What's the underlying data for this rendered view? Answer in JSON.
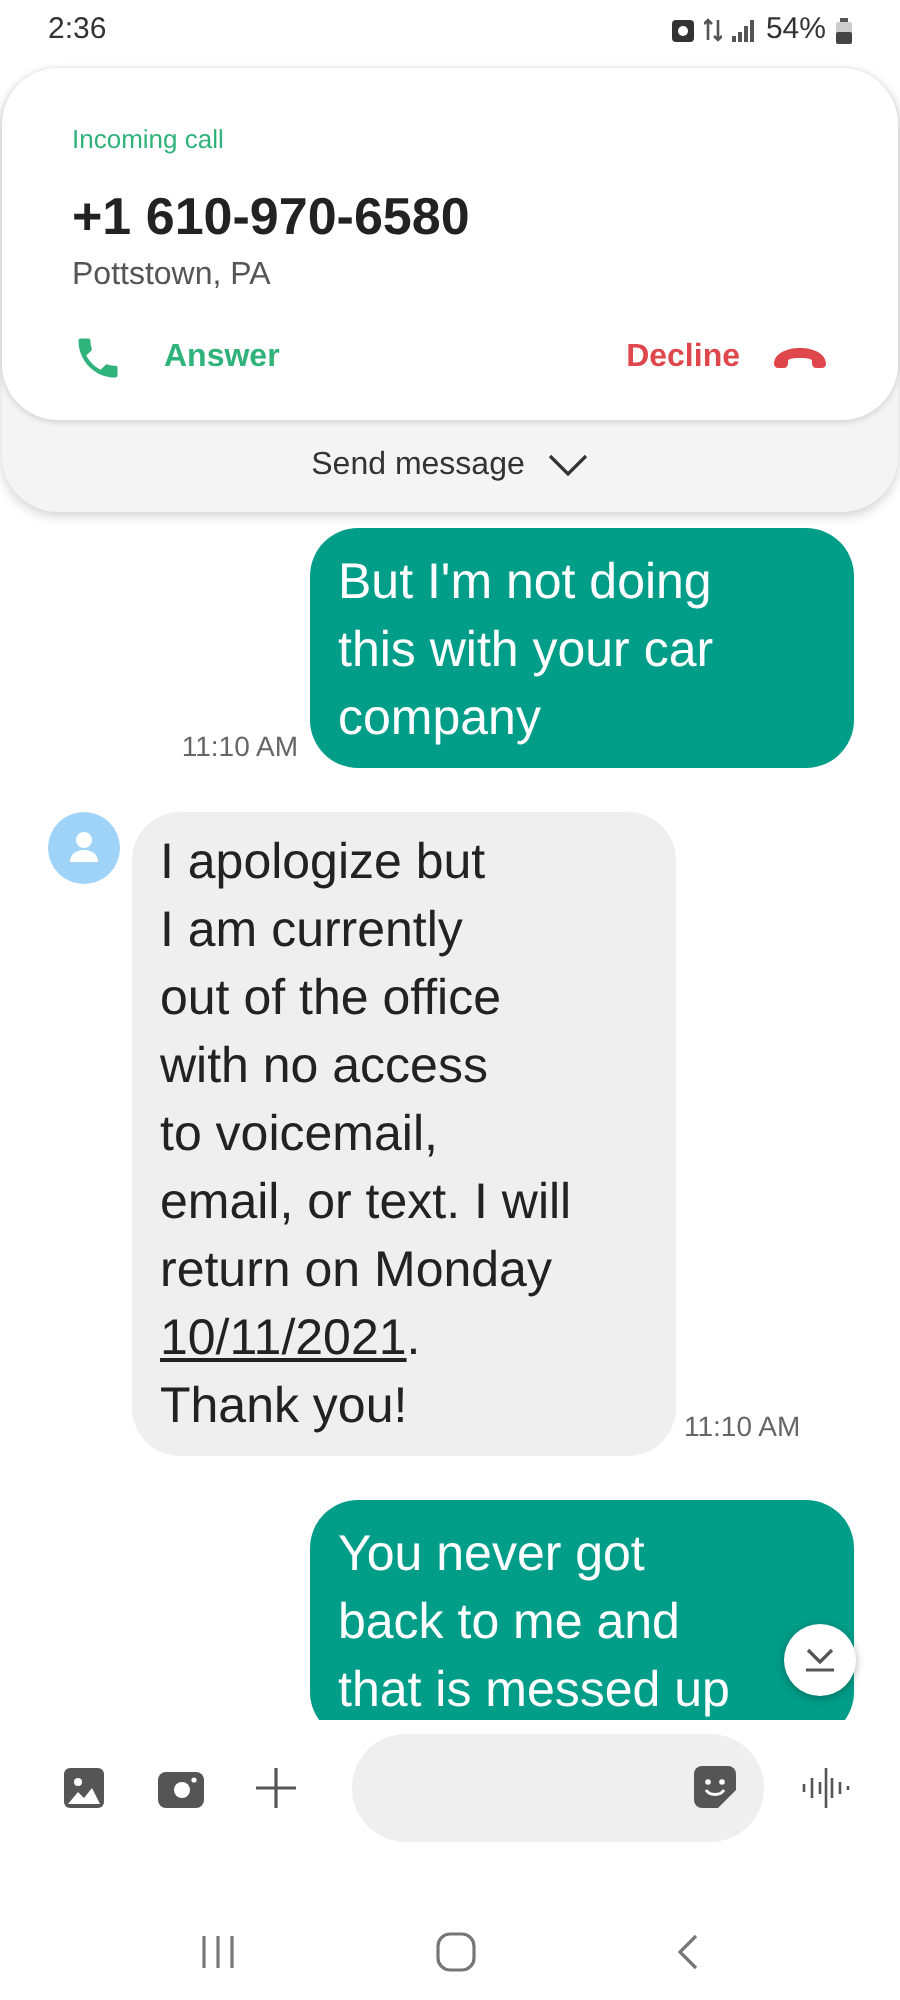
{
  "status_bar": {
    "time": "2:36",
    "battery": "54%"
  },
  "incoming_call": {
    "label": "Incoming call",
    "number": "+1 610-970-6580",
    "location": "Pottstown, PA",
    "answer": "Answer",
    "decline": "Decline",
    "send_message": "Send message"
  },
  "messages": [
    {
      "kind": "outgoing",
      "lines": [
        [
          {
            "kind": "text",
            "text": "But I'm not doing"
          }
        ],
        [
          {
            "kind": "text",
            "text": "this with your car"
          }
        ],
        [
          {
            "kind": "text",
            "text": "company"
          }
        ]
      ],
      "time": "11:10 AM"
    },
    {
      "kind": "incoming",
      "lines": [
        [
          {
            "kind": "text",
            "text": "I apologize but"
          }
        ],
        [
          {
            "kind": "text",
            "text": "I am currently"
          }
        ],
        [
          {
            "kind": "text",
            "text": "out of the office"
          }
        ],
        [
          {
            "kind": "text",
            "text": "with no access"
          }
        ],
        [
          {
            "kind": "text",
            "text": "to voicemail,"
          }
        ],
        [
          {
            "kind": "text",
            "text": "email, or text. I will"
          }
        ],
        [
          {
            "kind": "text",
            "text": "return on Monday"
          }
        ],
        [
          {
            "kind": "link",
            "text": "10/11/2021"
          },
          {
            "kind": "text",
            "text": "."
          }
        ],
        [
          {
            "kind": "text",
            "text": "Thank you!"
          }
        ]
      ],
      "time": "11:10 AM"
    },
    {
      "kind": "outgoing",
      "lines": [
        [
          {
            "kind": "text",
            "text": "You never got"
          }
        ],
        [
          {
            "kind": "text",
            "text": "back to me and"
          }
        ],
        [
          {
            "kind": "text",
            "text": "that is messed up"
          }
        ]
      ]
    }
  ]
}
